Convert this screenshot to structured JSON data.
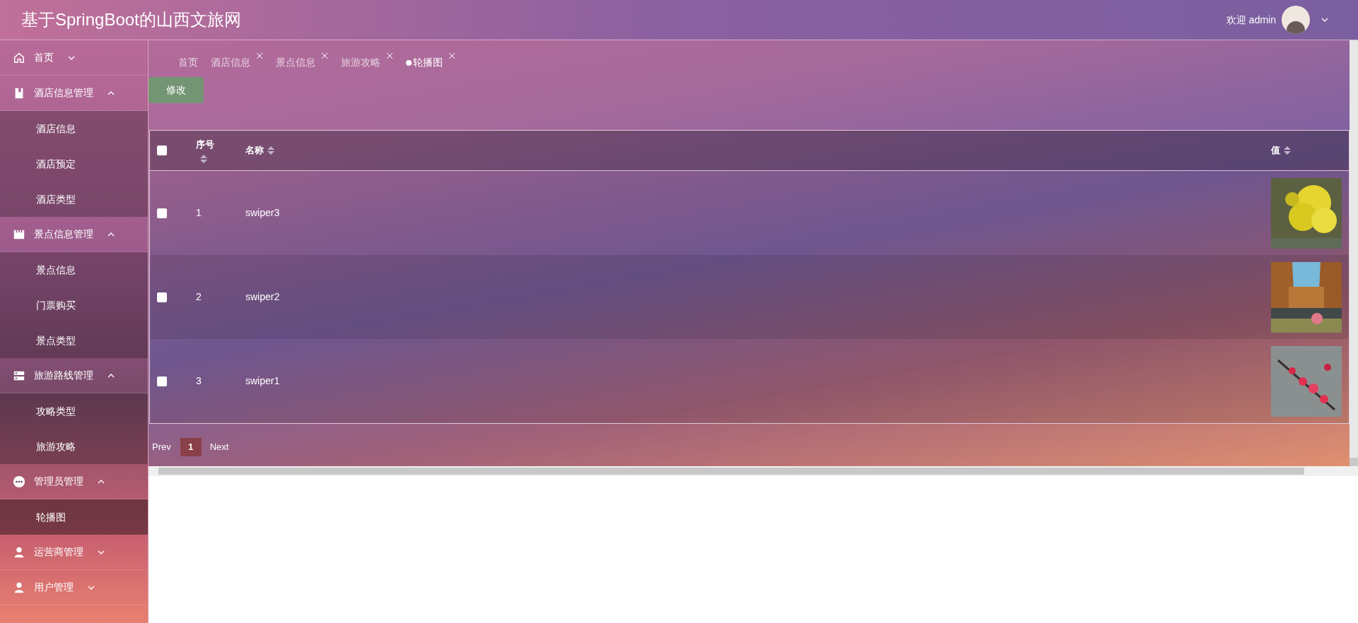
{
  "header": {
    "title": "基于SpringBoot的山西文旅网",
    "welcome": "欢迎 admin"
  },
  "sidebar": {
    "items": [
      {
        "label": "首页",
        "kind": "home",
        "expanded": false
      },
      {
        "label": "酒店信息管理",
        "kind": "bookmark",
        "expanded": true,
        "children": [
          {
            "label": "酒店信息",
            "selected": false
          },
          {
            "label": "酒店预定",
            "selected": false
          },
          {
            "label": "酒店类型",
            "selected": false
          }
        ]
      },
      {
        "label": "景点信息管理",
        "kind": "shop",
        "expanded": true,
        "children": [
          {
            "label": "景点信息",
            "selected": false
          },
          {
            "label": "门票购买",
            "selected": false
          },
          {
            "label": "景点类型",
            "selected": false
          }
        ]
      },
      {
        "label": "旅游路线管理",
        "kind": "server",
        "expanded": true,
        "children": [
          {
            "label": "攻略类型",
            "selected": false
          },
          {
            "label": "旅游攻略",
            "selected": false
          }
        ]
      },
      {
        "label": "管理员管理",
        "kind": "more",
        "expanded": true,
        "children": [
          {
            "label": "轮播图",
            "selected": true
          }
        ]
      },
      {
        "label": "运营商管理",
        "kind": "user",
        "expanded": false
      },
      {
        "label": "用户管理",
        "kind": "user",
        "expanded": false
      }
    ]
  },
  "tabs": [
    {
      "label": "首页",
      "closable": false,
      "selected": false
    },
    {
      "label": "酒店信息",
      "closable": true,
      "selected": false
    },
    {
      "label": "景点信息",
      "closable": true,
      "selected": false
    },
    {
      "label": "旅游攻略",
      "closable": true,
      "selected": false
    },
    {
      "label": "轮播图",
      "closable": true,
      "selected": true
    }
  ],
  "edit_button": "修改",
  "table": {
    "columns": [
      "序号",
      "名称",
      "值"
    ],
    "select_all_checked": false,
    "rows": [
      {
        "checked": false,
        "index": "1",
        "name": "swiper3"
      },
      {
        "checked": false,
        "index": "2",
        "name": "swiper2"
      },
      {
        "checked": false,
        "index": "3",
        "name": "swiper1"
      }
    ]
  },
  "pagination": {
    "prev": "Prev",
    "pages": [
      {
        "label": "1",
        "selected": true
      }
    ],
    "next": "Next"
  }
}
